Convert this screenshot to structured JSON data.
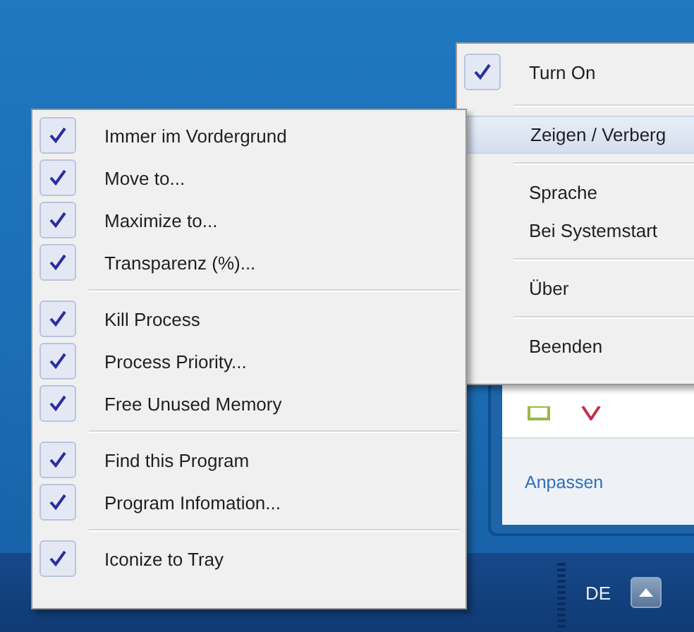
{
  "context_menu": {
    "groups": [
      [
        {
          "label": "Immer im Vordergrund",
          "checked": true
        },
        {
          "label": "Move to...",
          "checked": true
        },
        {
          "label": "Maximize to...",
          "checked": true
        },
        {
          "label": "Transparenz (%)...",
          "checked": true
        }
      ],
      [
        {
          "label": "Kill Process",
          "checked": true
        },
        {
          "label": "Process Priority...",
          "checked": true
        },
        {
          "label": "Free Unused Memory",
          "checked": true
        }
      ],
      [
        {
          "label": "Find this Program",
          "checked": true
        },
        {
          "label": "Program Infomation...",
          "checked": true
        }
      ],
      [
        {
          "label": "Iconize to Tray",
          "checked": true
        }
      ]
    ]
  },
  "tray_menu": {
    "groups": [
      [
        {
          "label": "Turn On",
          "checked": true,
          "selected": false
        }
      ],
      [
        {
          "label": "Zeigen / Verberg",
          "checked": false,
          "selected": true
        }
      ],
      [
        {
          "label": "Sprache",
          "checked": false,
          "selected": false
        },
        {
          "label": "Bei Systemstart",
          "checked": false,
          "selected": false
        }
      ],
      [
        {
          "label": "Über",
          "checked": false,
          "selected": false
        }
      ],
      [
        {
          "label": "Beenden",
          "checked": false,
          "selected": false
        }
      ]
    ]
  },
  "tray_flyout": {
    "link": "Anpassen"
  },
  "taskbar": {
    "language": "DE"
  }
}
